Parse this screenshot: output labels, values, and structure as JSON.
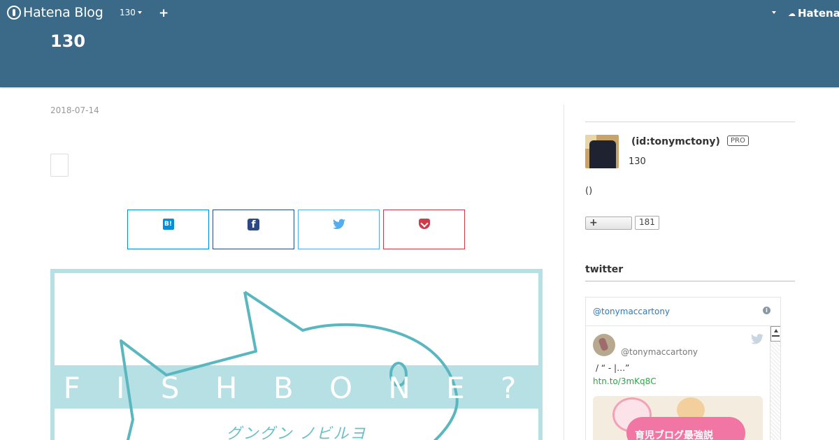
{
  "header": {
    "logo_text": "Hatena Blog",
    "blog_menu_label": "130",
    "add_label": "+",
    "hatena_label": "Hatena",
    "blog_title": "130"
  },
  "entry": {
    "date": "2018-07-14",
    "share_buttons": [
      {
        "name": "hatena-bookmark",
        "icon": "B!"
      },
      {
        "name": "facebook",
        "icon": "f"
      },
      {
        "name": "twitter",
        "icon": "twitter-bird-icon"
      },
      {
        "name": "pocket",
        "icon": "pocket-icon"
      }
    ],
    "hero": {
      "title": "F I S H B O N E ?",
      "subtitle": "グングン ノビルヨ"
    }
  },
  "sidebar": {
    "user_id": "(id:tonymctony)",
    "pro_badge": "PRO",
    "description": "130",
    "paren_text": "()",
    "subscribe_label": "+",
    "subscriber_count": "181",
    "twitter_heading": "twitter",
    "twitter_widget": {
      "handle": "@tonymaccartony",
      "info_icon": "i",
      "tweet_name": "@tonymaccartony",
      "tweet_text": "/ “ - |…”",
      "tweet_link": "htn.to/3mKq8C",
      "media_text": "育児ブログ最強説"
    }
  },
  "colors": {
    "header_bg": "#3b6a89",
    "hero_accent": "#b7e0e4",
    "hatena_bookmark": "#008fde",
    "facebook": "#2c4880",
    "twitter": "#55acee",
    "pocket": "#ce3b49"
  }
}
